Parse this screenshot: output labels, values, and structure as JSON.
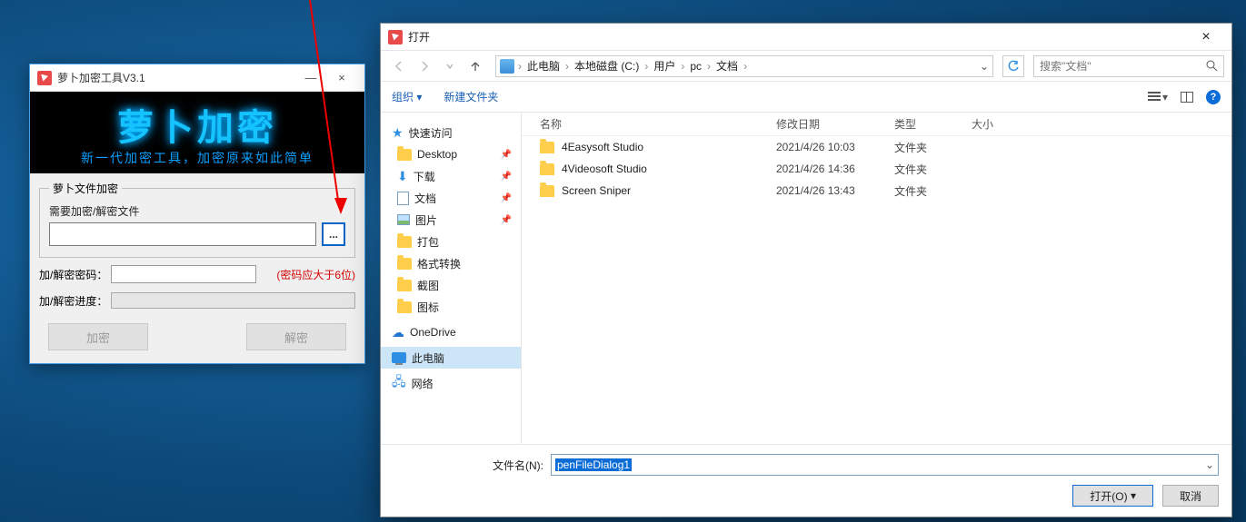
{
  "tool": {
    "title": "萝卜加密工具V3.1",
    "banner_big": "萝卜加密",
    "banner_small": "新一代加密工具，加密原来如此简单",
    "group_label": "萝卜文件加密",
    "file_label": "需要加密/解密文件",
    "browse_label": "...",
    "pw_label": "加/解密密码：",
    "pw_hint": "(密码应大于6位)",
    "prog_label": "加/解密进度：",
    "btn_encrypt": "加密",
    "btn_decrypt": "解密",
    "min": "—",
    "close": "×"
  },
  "dialog": {
    "title": "打开",
    "close": "×",
    "crumbs": [
      "此电脑",
      "本地磁盘 (C:)",
      "用户",
      "pc",
      "文档"
    ],
    "search_placeholder": "搜索\"文档\"",
    "toolbar": {
      "organize": "组织 ▾",
      "newfolder": "新建文件夹"
    },
    "tree": {
      "quick": "快速访问",
      "desktop": "Desktop",
      "downloads": "下载",
      "documents": "文档",
      "pictures": "图片",
      "pack": "打包",
      "convert": "格式转换",
      "shot": "截图",
      "icons": "图标",
      "onedrive": "OneDrive",
      "thispc": "此电脑",
      "network": "网络"
    },
    "columns": {
      "name": "名称",
      "date": "修改日期",
      "type": "类型",
      "size": "大小"
    },
    "rows": [
      {
        "name": "4Easysoft Studio",
        "date": "2021/4/26 10:03",
        "type": "文件夹"
      },
      {
        "name": "4Videosoft Studio",
        "date": "2021/4/26 14:36",
        "type": "文件夹"
      },
      {
        "name": "Screen Sniper",
        "date": "2021/4/26 13:43",
        "type": "文件夹"
      }
    ],
    "filename_label": "文件名(N):",
    "filename_value": "penFileDialog1",
    "btn_open": "打开(O)",
    "btn_cancel": "取消"
  }
}
